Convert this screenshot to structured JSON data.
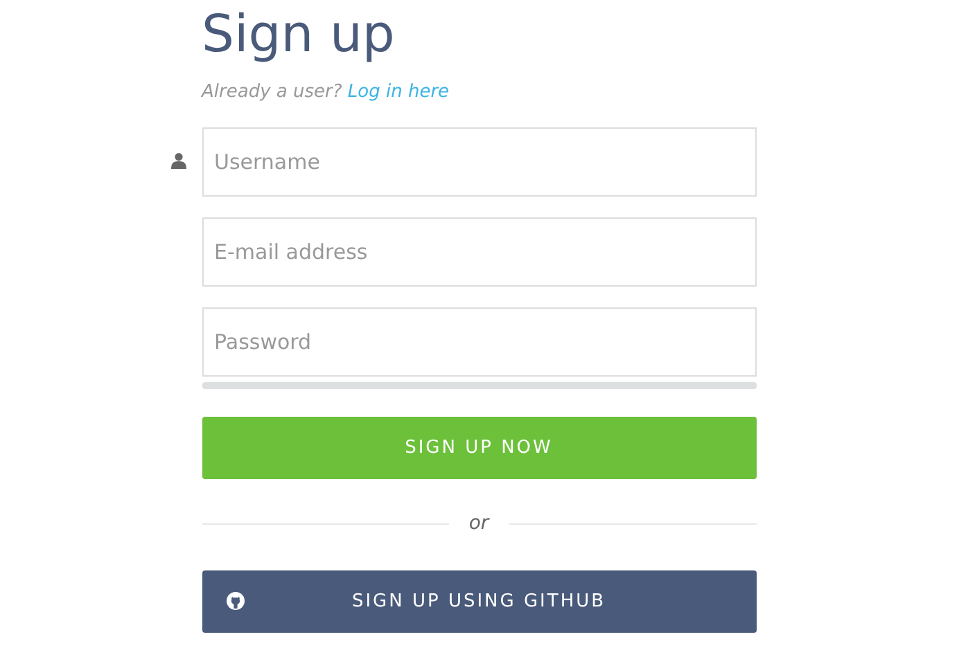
{
  "title": "Sign up",
  "login_prompt": {
    "text": "Already a user?",
    "link": "Log in here"
  },
  "fields": [
    {
      "placeholder": "Username",
      "kind": "user"
    },
    {
      "placeholder": "E-mail address",
      "kind": "plain"
    },
    {
      "placeholder": "Password",
      "kind": "password"
    }
  ],
  "password_strength": {
    "level": 0
  },
  "submit_button": "SIGN UP NOW",
  "divider_text": "or",
  "github_button": "SIGN UP USING GITHUB"
}
